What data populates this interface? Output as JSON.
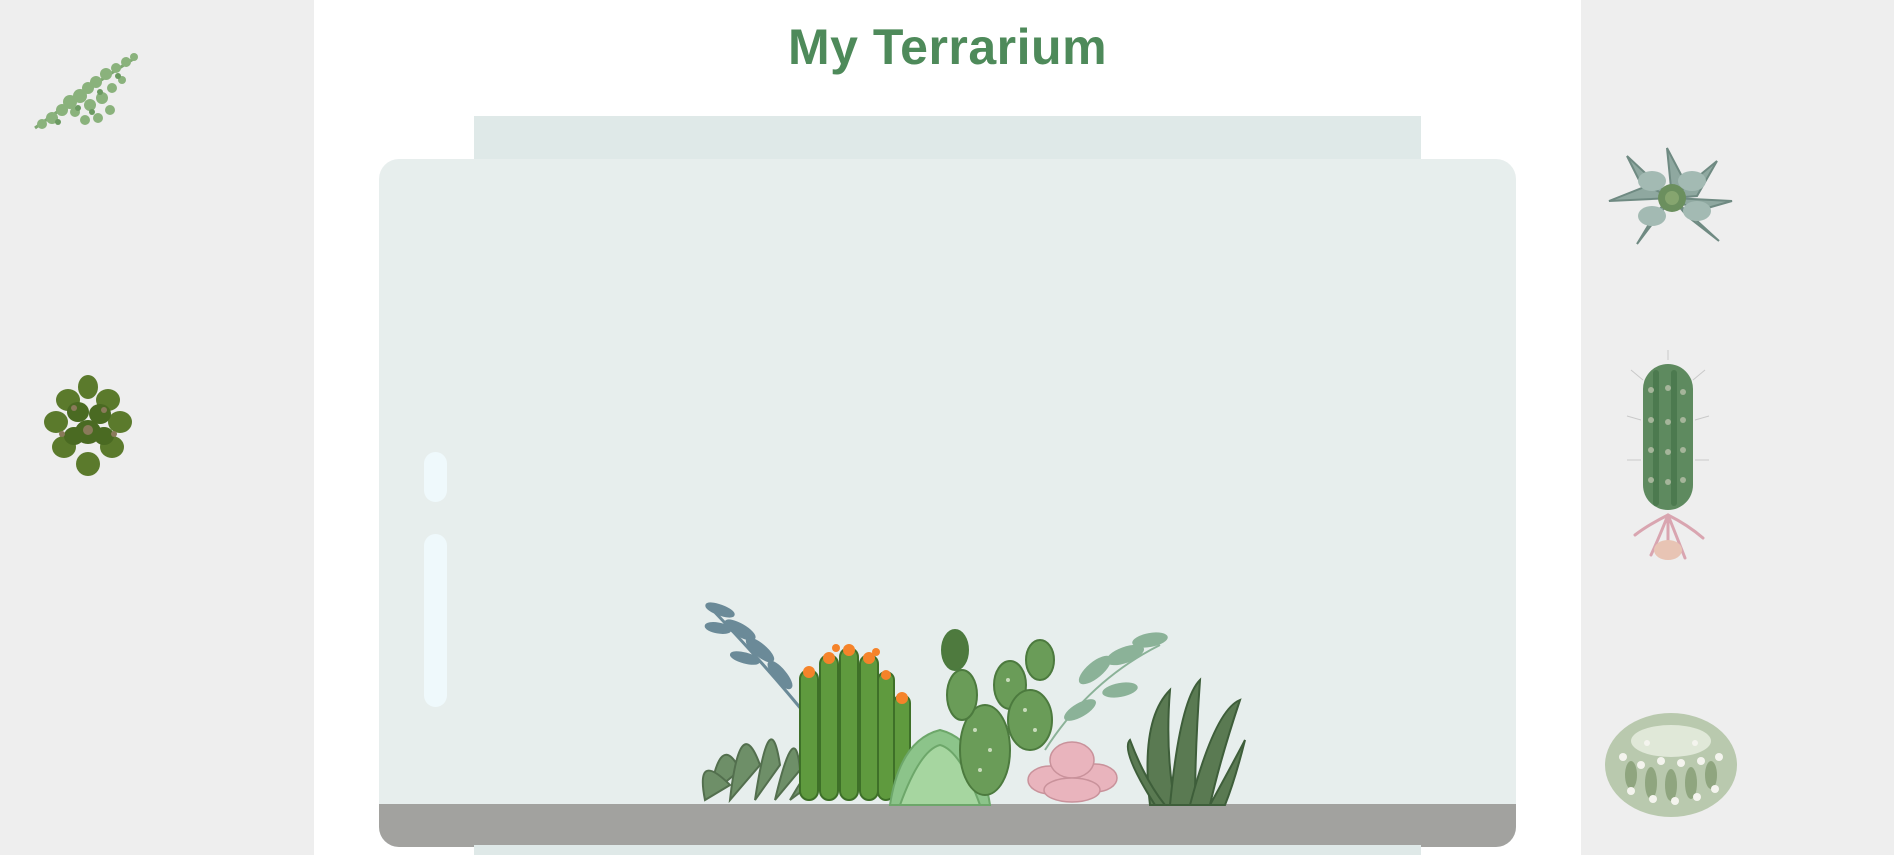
{
  "page": {
    "title": "My Terrarium"
  },
  "colors": {
    "title": "#4e8a5a",
    "side_panel": "#eeeeee",
    "jar_glass": "#e7eeed",
    "jar_lid": "#dfe9e8",
    "dirt": "#a2a29f",
    "glossy_highlight": "#eff9fc"
  },
  "left_container": {
    "plants": [
      {
        "id": "plant1",
        "icon": "trailing-vine-plant-icon"
      },
      {
        "id": "plant2",
        "icon": "dark-leafy-succulent-icon"
      }
    ]
  },
  "right_container": {
    "plants": [
      {
        "id": "plant3",
        "icon": "rosette-succulent-icon"
      },
      {
        "id": "plant4",
        "icon": "column-cactus-icon"
      },
      {
        "id": "plant5",
        "icon": "round-cactus-icon"
      }
    ]
  },
  "terrarium": {
    "arrangement_icon": "plant-arrangement-icon"
  }
}
